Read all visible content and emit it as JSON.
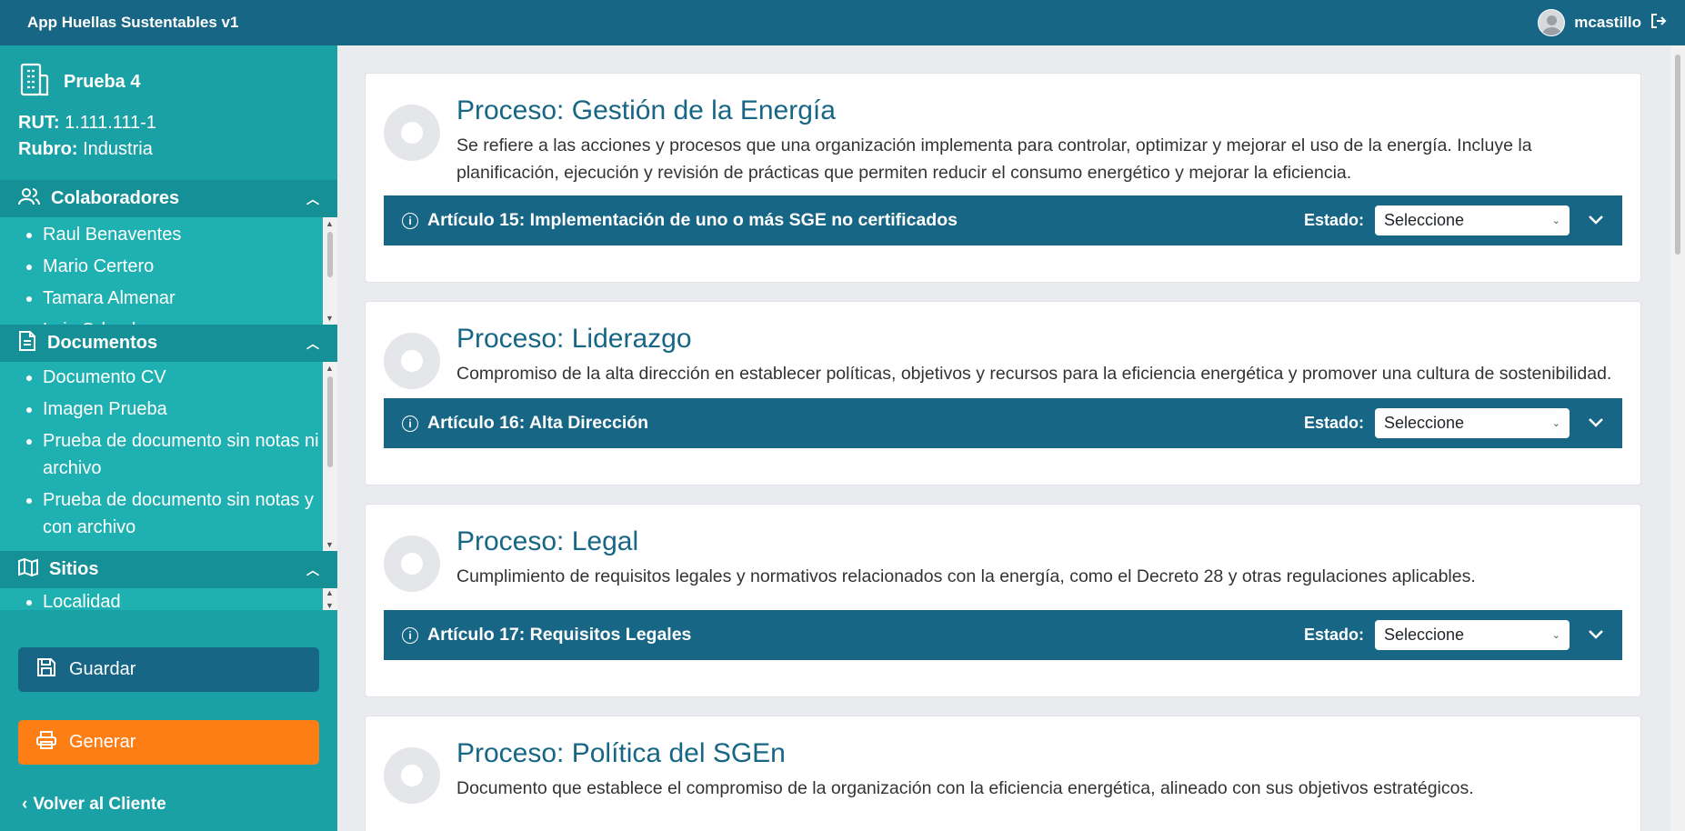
{
  "app": {
    "title": "App Huellas Sustentables v1",
    "user": "mcastillo"
  },
  "company": {
    "name": "Prueba 4",
    "rut_label": "RUT:",
    "rut": "1.111.111-1",
    "rubro_label": "Rubro:",
    "rubro": "Industria"
  },
  "sections": {
    "colaboradores": {
      "title": "Colaboradores",
      "items": [
        "Raul Benaventes",
        "Mario Certero",
        "Tamara Almenar",
        "Luis Orlando"
      ]
    },
    "documentos": {
      "title": "Documentos",
      "items": [
        "Documento CV",
        "Imagen Prueba",
        "Prueba de documento sin notas ni archivo",
        "Prueba de documento sin notas y con archivo"
      ]
    },
    "sitios": {
      "title": "Sitios",
      "items": [
        "Localidad"
      ]
    }
  },
  "actions": {
    "save": "Guardar",
    "generate": "Generar",
    "back": "Volver al Cliente"
  },
  "estado_label": "Estado:",
  "processes": [
    {
      "prefix": "Proceso:",
      "name": "Gestión de la Energía",
      "description": "Se refiere a las acciones y procesos que una organización implementa para controlar, optimizar y mejorar el uso de la energía. Incluye la planificación, ejecución y revisión de prácticas que permiten reducir el consumo energético y mejorar la eficiencia.",
      "article": "Artículo 15: Implementación de uno o más SGE no certificados",
      "estado": "Seleccione"
    },
    {
      "prefix": "Proceso:",
      "name": "Liderazgo",
      "description": "Compromiso de la alta dirección en establecer políticas, objetivos y recursos para la eficiencia energética y promover una cultura de sostenibilidad.",
      "article": "Artículo 16: Alta Dirección",
      "estado": "Seleccione"
    },
    {
      "prefix": "Proceso:",
      "name": "Legal",
      "description": "Cumplimiento de requisitos legales y normativos relacionados con la energía, como el Decreto 28 y otras regulaciones aplicables.",
      "article": "Artículo 17: Requisitos Legales",
      "estado": "Seleccione"
    },
    {
      "prefix": "Proceso:",
      "name": "Política del SGEn",
      "description": "Documento que establece el compromiso de la organización con la eficiencia energética, alineado con sus objetivos estratégicos."
    }
  ]
}
